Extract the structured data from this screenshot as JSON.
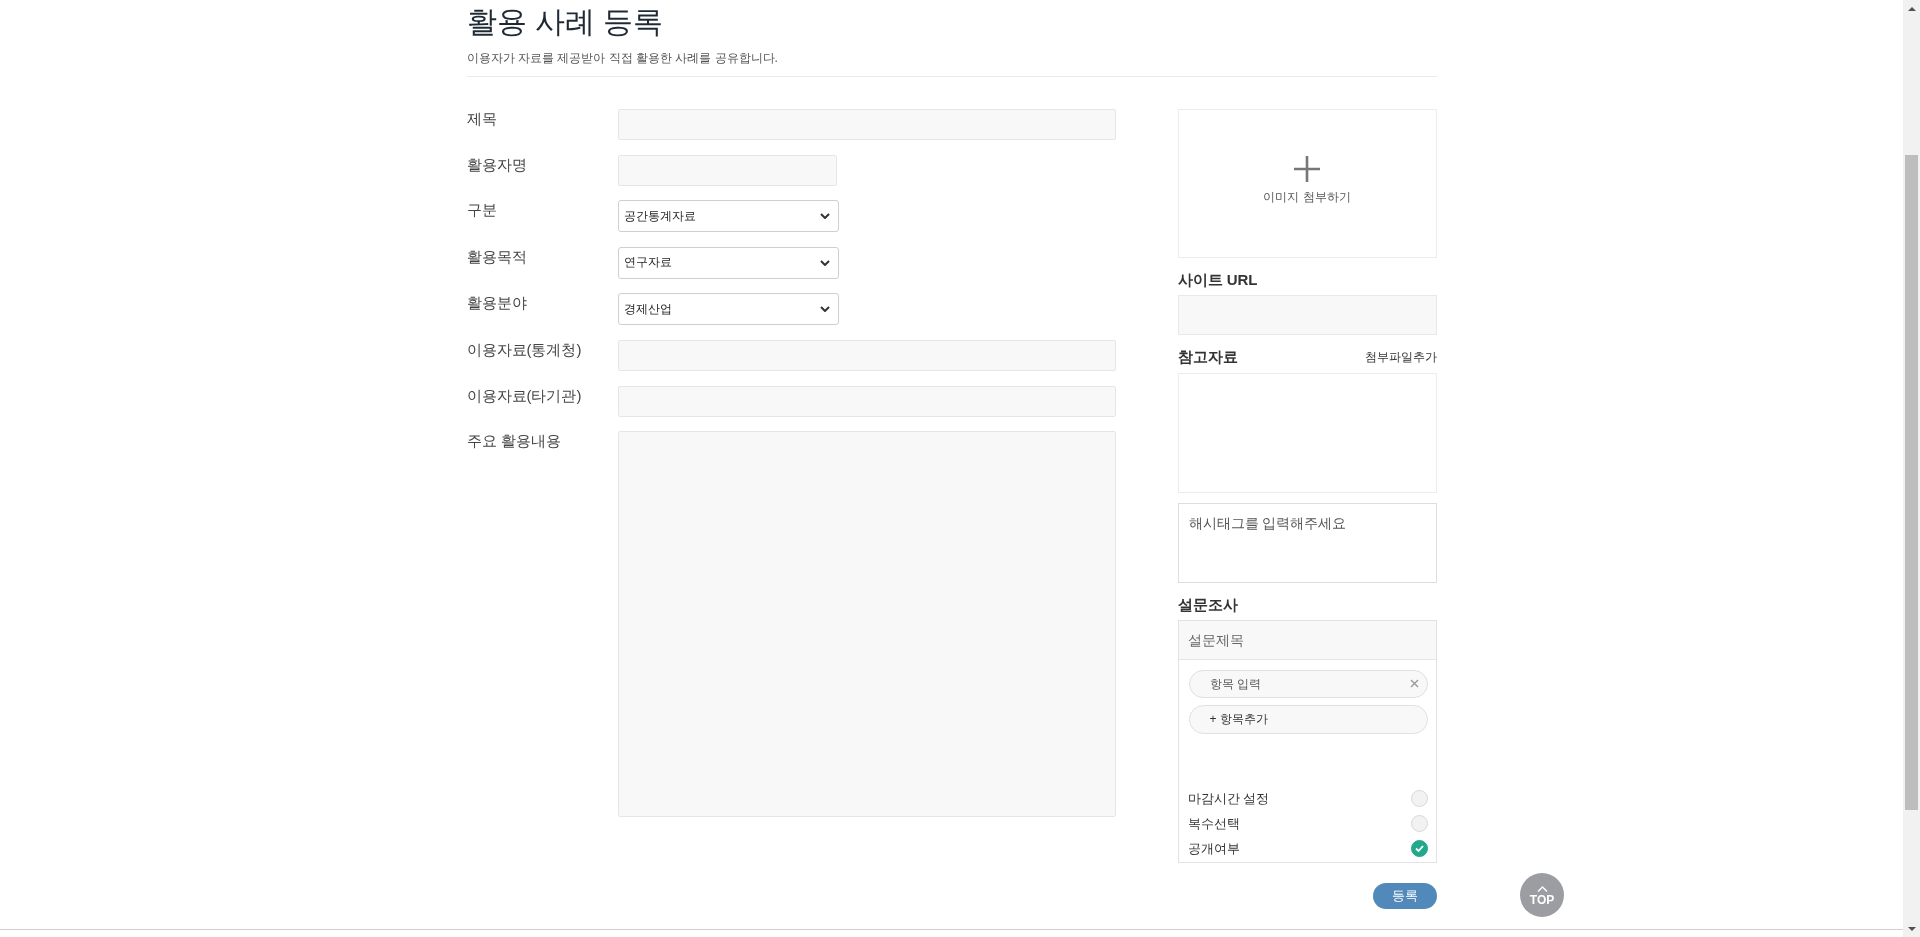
{
  "header": {
    "title": "활용 사례 등록",
    "subtitle": "이용자가 자료를 제공받아 직접 활용한 사례를 공유합니다."
  },
  "form": {
    "fields": [
      {
        "label": "제목",
        "kind": "text"
      },
      {
        "label": "활용자명",
        "kind": "short_text"
      },
      {
        "label": "구분",
        "kind": "select",
        "value": "공간통계자료"
      },
      {
        "label": "활용목적",
        "kind": "select",
        "value": "연구자료"
      },
      {
        "label": "활용분야",
        "kind": "select",
        "value": "경제산업"
      },
      {
        "label": "이용자료(통계청)",
        "kind": "text"
      },
      {
        "label": "이용자료(타기관)",
        "kind": "text"
      },
      {
        "label": "주요 활용내용",
        "kind": "textarea"
      }
    ]
  },
  "sidebar": {
    "image_upload": {
      "label": "이미지 첨부하기"
    },
    "site_url": {
      "label": "사이트 URL"
    },
    "references": {
      "label": "참고자료",
      "add_link": "첨부파일추가"
    },
    "hashtags": {
      "placeholder": "해시태그를 입력해주세요"
    },
    "survey": {
      "label": "설문조사",
      "title_placeholder": "설문제목",
      "items": [
        {
          "placeholder": "항목 입력"
        }
      ],
      "add_item": "+ 항목추가",
      "options": [
        {
          "label": "마감시간 설정",
          "checked": false
        },
        {
          "label": "복수선택",
          "checked": false
        },
        {
          "label": "공개여부",
          "checked": true
        }
      ]
    },
    "submit": "등록"
  },
  "top_button": {
    "label": "TOP"
  }
}
